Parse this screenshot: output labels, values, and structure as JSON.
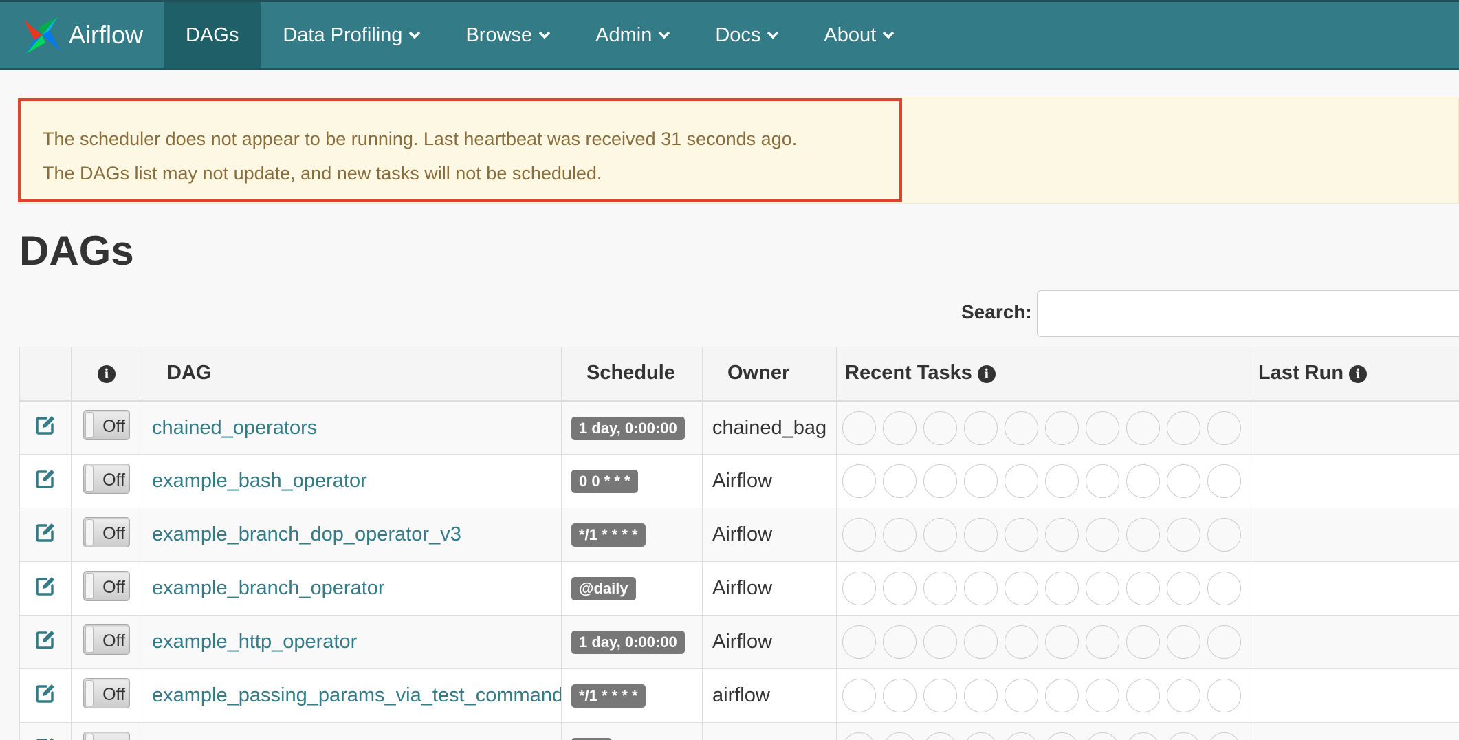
{
  "navbar": {
    "brand": "Airflow",
    "items": [
      {
        "label": "DAGs",
        "active": true
      },
      {
        "label": "Data Profiling",
        "dropdown": true
      },
      {
        "label": "Browse",
        "dropdown": true
      },
      {
        "label": "Admin",
        "dropdown": true
      },
      {
        "label": "Docs",
        "dropdown": true
      },
      {
        "label": "About",
        "dropdown": true
      }
    ],
    "color": "#337b86"
  },
  "alert": {
    "line1": "The scheduler does not appear to be running. Last heartbeat was received 31 seconds ago.",
    "line2": "The DAGs list may not update, and new tasks will not be scheduled."
  },
  "page": {
    "title": "DAGs"
  },
  "search": {
    "label": "Search:",
    "value": ""
  },
  "table": {
    "headers": {
      "info": "i",
      "dag": "DAG",
      "schedule": "Schedule",
      "owner": "Owner",
      "recent_tasks": "Recent Tasks",
      "last_run": "Last Run"
    },
    "rows": [
      {
        "toggle": "Off",
        "dag": "chained_operators",
        "schedule": "1 day, 0:00:00",
        "owner": "chained_bag"
      },
      {
        "toggle": "Off",
        "dag": "example_bash_operator",
        "schedule": "0 0 * * *",
        "owner": "Airflow"
      },
      {
        "toggle": "Off",
        "dag": "example_branch_dop_operator_v3",
        "schedule": "*/1 * * * *",
        "owner": "Airflow"
      },
      {
        "toggle": "Off",
        "dag": "example_branch_operator",
        "schedule": "@daily",
        "owner": "Airflow"
      },
      {
        "toggle": "Off",
        "dag": "example_http_operator",
        "schedule": "1 day, 0:00:00",
        "owner": "Airflow"
      },
      {
        "toggle": "Off",
        "dag": "example_passing_params_via_test_command",
        "schedule": "*/1 * * * *",
        "owner": "airflow"
      }
    ]
  }
}
